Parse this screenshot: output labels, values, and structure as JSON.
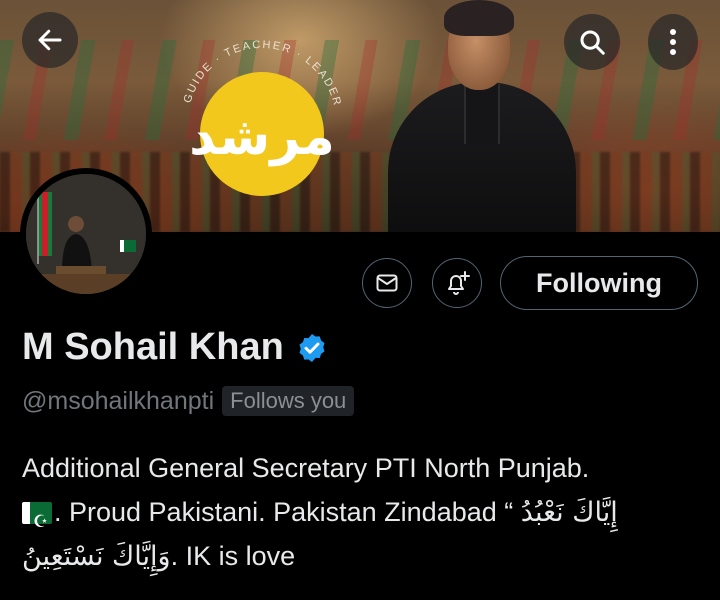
{
  "header": {
    "back_icon": "arrow-left-icon",
    "search_icon": "search-icon",
    "more_icon": "more-vertical-icon"
  },
  "banner": {
    "logo_ring_text": "GUIDE · TEACHER · LEADER",
    "logo_center_text": "مرشد",
    "logo_color": "#f2c81d"
  },
  "actions": {
    "message_icon": "envelope-icon",
    "notify_icon": "bell-plus-icon",
    "following_label": "Following"
  },
  "profile": {
    "name": "M Sohail Khan",
    "verified_icon": "verified-badge-icon",
    "verified_color": "#1d9bf0",
    "handle": "@msohailkhanpti",
    "follows_you": "Follows you",
    "bio_line1": "Additional General Secretary PTI North Punjab.",
    "bio_line2_text": ". Proud Pakistani. Pakistan Zindabad “",
    "bio_line2_arabic": "إِيَّاكَ نَعْبُدُ",
    "bio_line3_arabic": "وَإِيَّاكَ نَسْتَعِينُ",
    "bio_line3_text": ". IK is love",
    "flag_icon": "pakistan-flag-icon"
  },
  "colors": {
    "background": "#000000",
    "text": "#e7e9ea",
    "secondary_text": "#71767b",
    "border": "#536471"
  }
}
